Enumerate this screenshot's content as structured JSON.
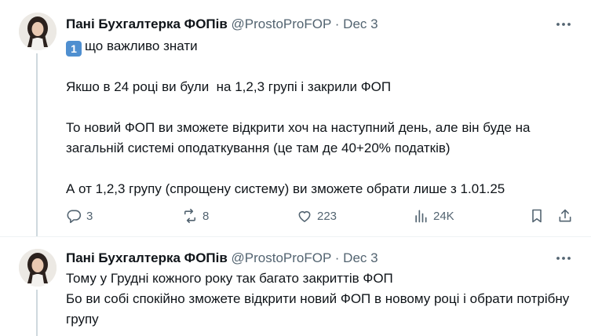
{
  "tweets": [
    {
      "author_name": "Пані Бухгалтерка ФОПів",
      "handle": "@ProstoProFOP",
      "separator": "·",
      "date": "Dec 3",
      "keycap": "1",
      "lines": {
        "l1": "що важливо знати",
        "l2": "Якшо в 24 році ви були  на 1,2,3 групі і закрили ФОП",
        "l3": "То новий ФОП ви зможете відкрити хоч на наступний день, але він буде на загальній системі оподаткування (це там де 40+20% податків)",
        "l4": "А от 1,2,3 групу (спрощену систему) ви зможете обрати лише з 1.01.25"
      },
      "stats": {
        "replies": "3",
        "reposts": "8",
        "likes": "223",
        "views": "24K"
      }
    },
    {
      "author_name": "Пані Бухгалтерка ФОПів",
      "handle": "@ProstoProFOP",
      "separator": "·",
      "date": "Dec 3",
      "lines": {
        "l1": "Тому у Грудні кожного року так багато закриттів ФОП",
        "l2": "Бо ви собі спокійно зможете відкрити новий ФОП в новому році і обрати потрібну групу"
      }
    }
  ],
  "icons": {
    "more": "more-horizontal-icon",
    "reply": "reply-icon",
    "repost": "repost-icon",
    "like": "heart-icon",
    "views": "views-chart-icon",
    "bookmark": "bookmark-icon",
    "share": "share-icon"
  },
  "colors": {
    "text_primary": "#0f1419",
    "text_secondary": "#536471",
    "thread_line": "#cfd9de",
    "keycap_blue": "#4f8fd0"
  }
}
